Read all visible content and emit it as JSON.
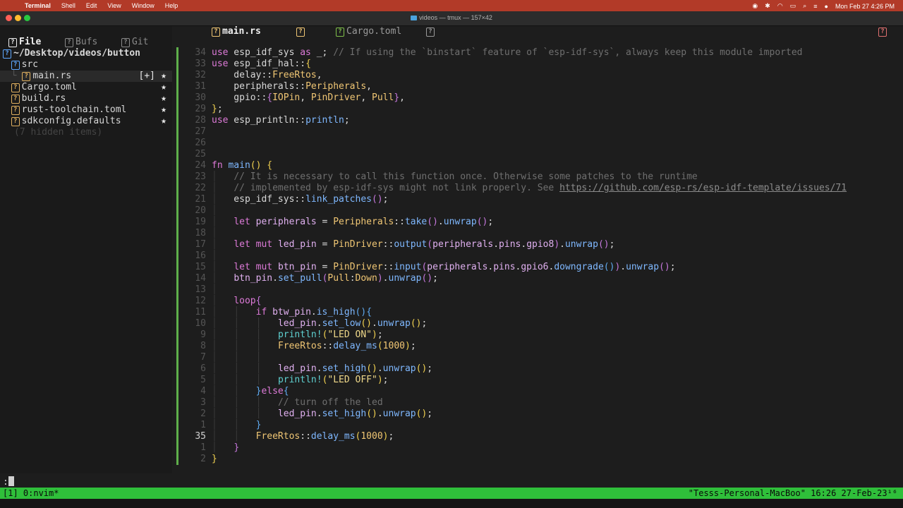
{
  "menubar": {
    "apple": "",
    "menus": [
      "Terminal",
      "Shell",
      "Edit",
      "View",
      "Window",
      "Help"
    ],
    "datetime": "Mon Feb 27  4:26 PM"
  },
  "window": {
    "title": "videos — tmux — 157×42",
    "traffic_colors": [
      "#ff5f57",
      "#febc2e",
      "#28c840"
    ]
  },
  "sidebar": {
    "tabs": [
      "File",
      "Bufs",
      "Git"
    ],
    "root": "~/Desktop/videos/button",
    "tree": [
      {
        "name": "src",
        "prefix": "  ",
        "dir": true,
        "mod": "",
        "star": ""
      },
      {
        "name": "main.rs",
        "prefix": "  └ ",
        "dir": false,
        "mod": "[+]",
        "star": "★"
      },
      {
        "name": "Cargo.toml",
        "prefix": "  ",
        "dir": false,
        "mod": "",
        "star": "★"
      },
      {
        "name": "build.rs",
        "prefix": "  ",
        "dir": false,
        "mod": "",
        "star": "★"
      },
      {
        "name": "rust-toolchain.toml",
        "prefix": "  ",
        "dir": false,
        "mod": "",
        "star": "★"
      },
      {
        "name": "sdkconfig.defaults",
        "prefix": "  ",
        "dir": false,
        "mod": "",
        "star": "★"
      }
    ],
    "hidden": "(7 hidden items)"
  },
  "editor": {
    "tabs": [
      "main.rs",
      "Cargo.toml"
    ],
    "current_line": "35",
    "lines": [
      {
        "n": "34",
        "html": "<span class='kw'>use</span> esp_idf_sys <span class='kw'>as</span> _; <span class='cm'>// If using the `binstart` feature of `esp-idf-sys`, always keep this module imported</span>"
      },
      {
        "n": "33",
        "html": "<span class='kw'>use</span> esp_idf_hal::<span class='p1'>{</span>"
      },
      {
        "n": "32",
        "html": "    delay::<span class='ty'>FreeRtos</span>,"
      },
      {
        "n": "31",
        "html": "    peripherals::<span class='ty'>Peripherals</span>,"
      },
      {
        "n": "30",
        "html": "    gpio::<span class='p2'>{</span><span class='ty'>IOPin</span>, <span class='ty'>PinDriver</span>, <span class='ty'>Pull</span><span class='p2'>}</span>,"
      },
      {
        "n": "29",
        "html": "<span class='p1'>}</span>;"
      },
      {
        "n": "28",
        "html": "<span class='kw'>use</span> esp_println::<span class='fn'>println</span>;"
      },
      {
        "n": "27",
        "html": ""
      },
      {
        "n": "26",
        "html": ""
      },
      {
        "n": "25",
        "html": ""
      },
      {
        "n": "24",
        "html": "<span class='kw'>fn</span> <span class='fn'>main</span><span class='p1'>()</span> <span class='p1'>{</span>"
      },
      {
        "n": "23",
        "html": "<span class='guide'>│</span>   <span class='cm'>// It is necessary to call this function once. Otherwise some patches to the runtime</span>"
      },
      {
        "n": "22",
        "html": "<span class='guide'>│</span>   <span class='cm'>// implemented by esp-idf-sys might not link properly. See </span><span class='url'>https://github.com/esp-rs/esp-idf-template/issues/71</span>"
      },
      {
        "n": "21",
        "html": "<span class='guide'>│</span>   esp_idf_sys::<span class='fn'>link_patches</span><span class='p2'>()</span>;"
      },
      {
        "n": "20",
        "html": "<span class='guide'>│</span>"
      },
      {
        "n": "19",
        "html": "<span class='guide'>│</span>   <span class='kw'>let</span> <span class='k'>peripherals</span> = <span class='ty'>Peripherals</span>::<span class='fn'>take</span><span class='p2'>()</span>.<span class='fn'>unwrap</span><span class='p2'>()</span>;"
      },
      {
        "n": "18",
        "html": "<span class='guide'>│</span>"
      },
      {
        "n": "17",
        "html": "<span class='guide'>│</span>   <span class='kw'>let</span> <span class='kw'>mut</span> <span class='k'>led_pin</span> = <span class='ty'>PinDriver</span>::<span class='fn'>output</span><span class='p2'>(</span><span class='k'>peripherals</span>.<span class='k'>pins</span>.<span class='k'>gpio8</span><span class='p2'>)</span>.<span class='fn'>unwrap</span><span class='p2'>()</span>;"
      },
      {
        "n": "16",
        "html": "<span class='guide'>│</span>"
      },
      {
        "n": "15",
        "html": "<span class='guide'>│</span>   <span class='kw'>let</span> <span class='kw'>mut</span> <span class='k'>btn_pin</span> = <span class='ty'>PinDriver</span>::<span class='fn'>input</span><span class='p2'>(</span><span class='k'>peripherals</span>.<span class='k'>pins</span>.<span class='k'>gpio6</span>.<span class='fn'>downgrade</span><span class='p3'>()</span><span class='p2'>)</span>.<span class='fn'>unwrap</span><span class='p2'>()</span>;"
      },
      {
        "n": "14",
        "html": "<span class='guide'>│</span>   <span class='k'>btn_pin</span>.<span class='fn'>set_pull</span><span class='p2'>(</span><span class='ty'>Pull</span>:<span class='ty'>Down</span><span class='p2'>)</span>.<span class='fn'>unwrap</span><span class='p2'>()</span>;"
      },
      {
        "n": "13",
        "html": "<span class='guide'>│</span>"
      },
      {
        "n": "12",
        "html": "<span class='guide'>│</span>   <span class='kw'>loop</span><span class='p2'>{</span>"
      },
      {
        "n": "11",
        "html": "<span class='guide'>│</span>   <span class='guide'>│</span>   <span class='kw'>if</span> <span class='k'>btw_pin</span>.<span class='fn'>is_high</span><span class='p3'>()</span><span class='p3'>{</span>"
      },
      {
        "n": "10",
        "html": "<span class='guide'>│</span>   <span class='guide'>│</span>   <span class='guide'>│</span>   <span class='k'>led_pin</span>.<span class='fn'>set_low</span><span class='p1'>()</span>.<span class='fn'>unwrap</span><span class='p1'>()</span>;"
      },
      {
        "n": "9",
        "html": "<span class='guide'>│</span>   <span class='guide'>│</span>   <span class='guide'>│</span>   <span class='mac'>println!</span><span class='p1'>(</span><span class='st'>\"LED ON\"</span><span class='p1'>)</span>;"
      },
      {
        "n": "8",
        "html": "<span class='guide'>│</span>   <span class='guide'>│</span>   <span class='guide'>│</span>   <span class='ty'>FreeRtos</span>::<span class='fn'>delay_ms</span><span class='p1'>(</span><span class='nm'>1000</span><span class='p1'>)</span>;"
      },
      {
        "n": "7",
        "html": "<span class='guide'>│</span>   <span class='guide'>│</span>   <span class='guide'>│</span>"
      },
      {
        "n": "6",
        "html": "<span class='guide'>│</span>   <span class='guide'>│</span>   <span class='guide'>│</span>   <span class='k'>led_pin</span>.<span class='fn'>set_high</span><span class='p1'>()</span>.<span class='fn'>unwrap</span><span class='p1'>()</span>;"
      },
      {
        "n": "5",
        "html": "<span class='guide'>│</span>   <span class='guide'>│</span>   <span class='guide'>│</span>   <span class='mac'>println!</span><span class='p1'>(</span><span class='st'>\"LED OFF\"</span><span class='p1'>)</span>;"
      },
      {
        "n": "4",
        "html": "<span class='guide'>│</span>   <span class='guide'>│</span>   <span class='p3'>}</span><span class='kw'>else</span><span class='p3'>{</span>"
      },
      {
        "n": "3",
        "html": "<span class='guide'>│</span>   <span class='guide'>│</span>   <span class='guide'>│</span>   <span class='cm'>// turn off the led</span>"
      },
      {
        "n": "2",
        "html": "<span class='guide'>│</span>   <span class='guide'>│</span>   <span class='guide'>│</span>   <span class='k'>led_pin</span>.<span class='fn'>set_high</span><span class='p1'>()</span>.<span class='fn'>unwrap</span><span class='p1'>()</span>;"
      },
      {
        "n": "1",
        "html": "<span class='guide'>│</span>   <span class='guide'>│</span>   <span class='p3'>}</span>"
      },
      {
        "n": "35",
        "html": "<span class='guide'>│</span>   <span class='guide'>│</span>   <span class='ty'>FreeRtos</span>::<span class='fn'>delay_ms</span><span class='p1'>(</span><span class='nm'>1000</span><span class='p1'>)</span>;"
      },
      {
        "n": "1",
        "html": "<span class='guide'>│</span>   <span class='p2'>}</span>"
      },
      {
        "n": "2",
        "html": "<span class='p1'>}</span>"
      }
    ]
  },
  "cmdline": ":",
  "tmux": {
    "left": "[1] 0:nvim*",
    "right": "\"Tesss-Personal-MacBoo\" 16:26 27-Feb-23¹⁶"
  }
}
